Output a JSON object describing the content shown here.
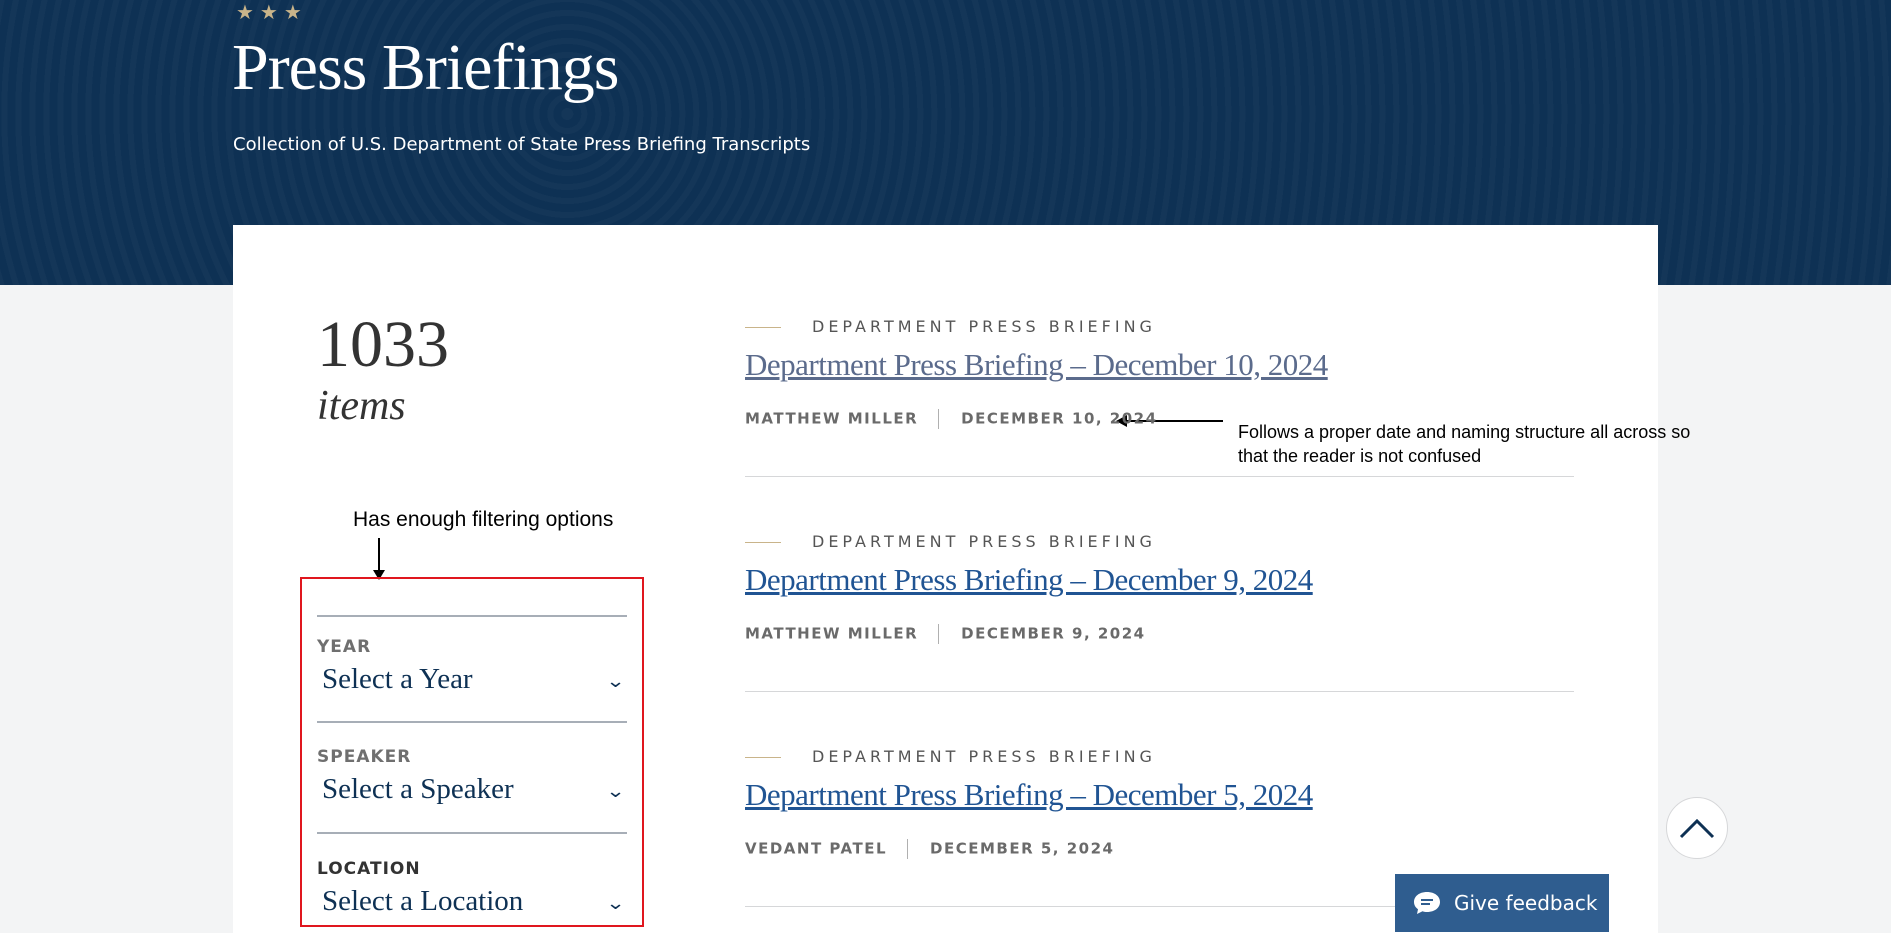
{
  "hero": {
    "stars": "★★★",
    "title": "Press Briefings",
    "subtitle": "Collection of U.S. Department of State Press Briefing Transcripts"
  },
  "summary": {
    "count": "1033",
    "count_label": "items"
  },
  "annotations": {
    "filter_note": "Has enough filtering options",
    "date_note": "Follows a proper date and naming structure all across so that the reader is not confused"
  },
  "filters": [
    {
      "label": "YEAR",
      "placeholder": "Select a Year"
    },
    {
      "label": "SPEAKER",
      "placeholder": "Select a Speaker"
    },
    {
      "label": "LOCATION",
      "placeholder": "Select a Location"
    }
  ],
  "briefings": [
    {
      "category": "DEPARTMENT PRESS BRIEFING",
      "title": "Department Press Briefing – December 10, 2024",
      "speaker": "MATTHEW MILLER",
      "date": "DECEMBER 10, 2024"
    },
    {
      "category": "DEPARTMENT PRESS BRIEFING",
      "title": "Department Press Briefing – December 9, 2024",
      "speaker": "MATTHEW MILLER",
      "date": "DECEMBER 9, 2024"
    },
    {
      "category": "DEPARTMENT PRESS BRIEFING",
      "title": "Department Press Briefing – December 5, 2024",
      "speaker": "VEDANT PATEL",
      "date": "DECEMBER 5, 2024"
    }
  ],
  "feedback": {
    "label": "Give feedback"
  },
  "icons": {
    "back_to_top": "chevron-up-icon",
    "feedback": "chat-bubble-icon",
    "select": "chevron-down-icon"
  },
  "colors": {
    "hero_bg": "#0e3154",
    "link": "#205493",
    "accent_gold": "#c9b48a",
    "highlight_red": "#e0161e",
    "feedback_bg": "#2f5d8f"
  }
}
